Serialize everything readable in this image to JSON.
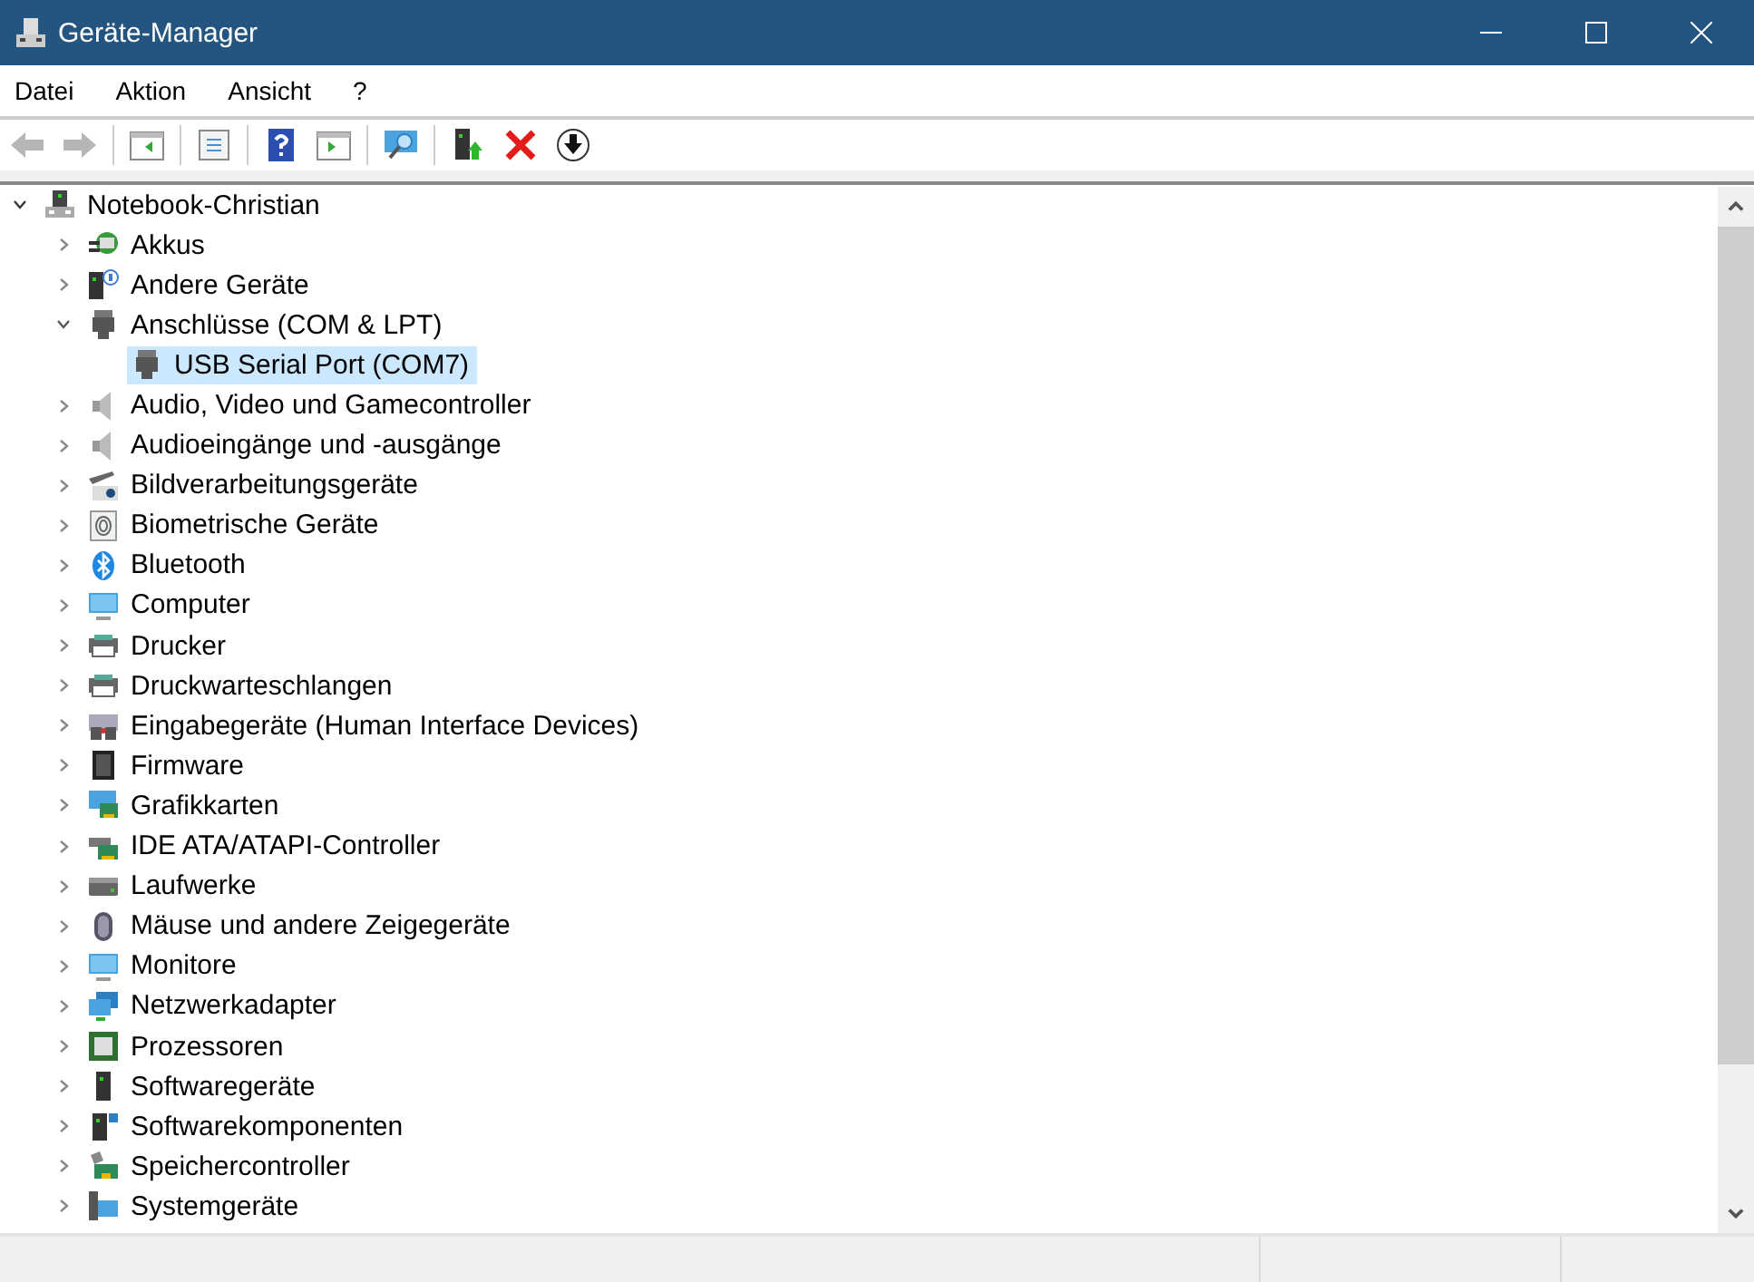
{
  "window": {
    "title": "Geräte-Manager"
  },
  "menu": [
    "Datei",
    "Aktion",
    "Ansicht",
    "?"
  ],
  "toolbar": [
    {
      "disabled": true
    },
    {
      "disabled": true
    },
    {
      "disabled": false
    },
    {
      "disabled": false
    },
    {
      "disabled": false
    },
    {
      "disabled": false
    },
    {
      "disabled": false
    },
    {
      "disabled": false
    },
    {
      "disabled": false
    },
    {
      "disabled": false
    }
  ],
  "tree": {
    "label": "Notebook-Christian",
    "expanded": true,
    "selected": false,
    "children": [
      {
        "label": "Akkus",
        "expanded": false,
        "selected": false
      },
      {
        "label": "Andere Geräte",
        "expanded": false,
        "selected": false
      },
      {
        "label": "Anschlüsse (COM & LPT)",
        "expanded": true,
        "selected": false,
        "children": [
          {
            "label": "USB Serial Port (COM7)",
            "selected": true
          }
        ]
      },
      {
        "label": "Audio, Video und Gamecontroller",
        "expanded": false,
        "selected": false
      },
      {
        "label": "Audioeingänge und -ausgänge",
        "expanded": false,
        "selected": false
      },
      {
        "label": "Bildverarbeitungsgeräte",
        "expanded": false,
        "selected": false
      },
      {
        "label": "Biometrische Geräte",
        "expanded": false,
        "selected": false
      },
      {
        "label": "Bluetooth",
        "expanded": false,
        "selected": false
      },
      {
        "label": "Computer",
        "expanded": false,
        "selected": false
      },
      {
        "label": "Drucker",
        "expanded": false,
        "selected": false
      },
      {
        "label": "Druckwarteschlangen",
        "expanded": false,
        "selected": false
      },
      {
        "label": "Eingabegeräte (Human Interface Devices)",
        "expanded": false,
        "selected": false
      },
      {
        "label": "Firmware",
        "expanded": false,
        "selected": false
      },
      {
        "label": "Grafikkarten",
        "expanded": false,
        "selected": false
      },
      {
        "label": "IDE ATA/ATAPI-Controller",
        "expanded": false,
        "selected": false
      },
      {
        "label": "Laufwerke",
        "expanded": false,
        "selected": false
      },
      {
        "label": "Mäuse und andere Zeigegeräte",
        "expanded": false,
        "selected": false
      },
      {
        "label": "Monitore",
        "expanded": false,
        "selected": false
      },
      {
        "label": "Netzwerkadapter",
        "expanded": false,
        "selected": false
      },
      {
        "label": "Prozessoren",
        "expanded": false,
        "selected": false
      },
      {
        "label": "Softwaregeräte",
        "expanded": false,
        "selected": false
      },
      {
        "label": "Softwarekomponenten",
        "expanded": false,
        "selected": false
      },
      {
        "label": "Speichercontroller",
        "expanded": false,
        "selected": false
      },
      {
        "label": "Systemgeräte",
        "expanded": false,
        "selected": false
      }
    ]
  }
}
